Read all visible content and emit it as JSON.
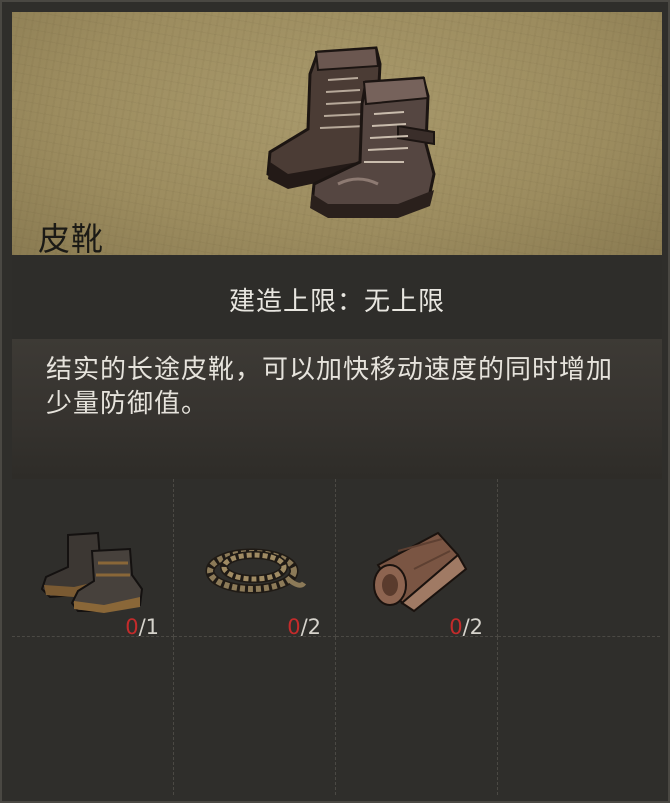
{
  "item": {
    "name": "皮靴",
    "image_icon": "leather-boots-icon"
  },
  "limit": {
    "text": "建造上限：无上限"
  },
  "description": {
    "text": "结实的长途皮靴，可以加快移动速度的同时增加少量防御值。"
  },
  "materials": [
    {
      "icon": "boots-material-icon",
      "have": "0",
      "need": "/1"
    },
    {
      "icon": "rope-icon",
      "have": "0",
      "need": "/2"
    },
    {
      "icon": "leather-roll-icon",
      "have": "0",
      "need": "/2"
    }
  ],
  "colors": {
    "header_bg": "#9c8c5f",
    "panel_bg": "#2f2e2b",
    "missing_count": "#c42b2b"
  }
}
